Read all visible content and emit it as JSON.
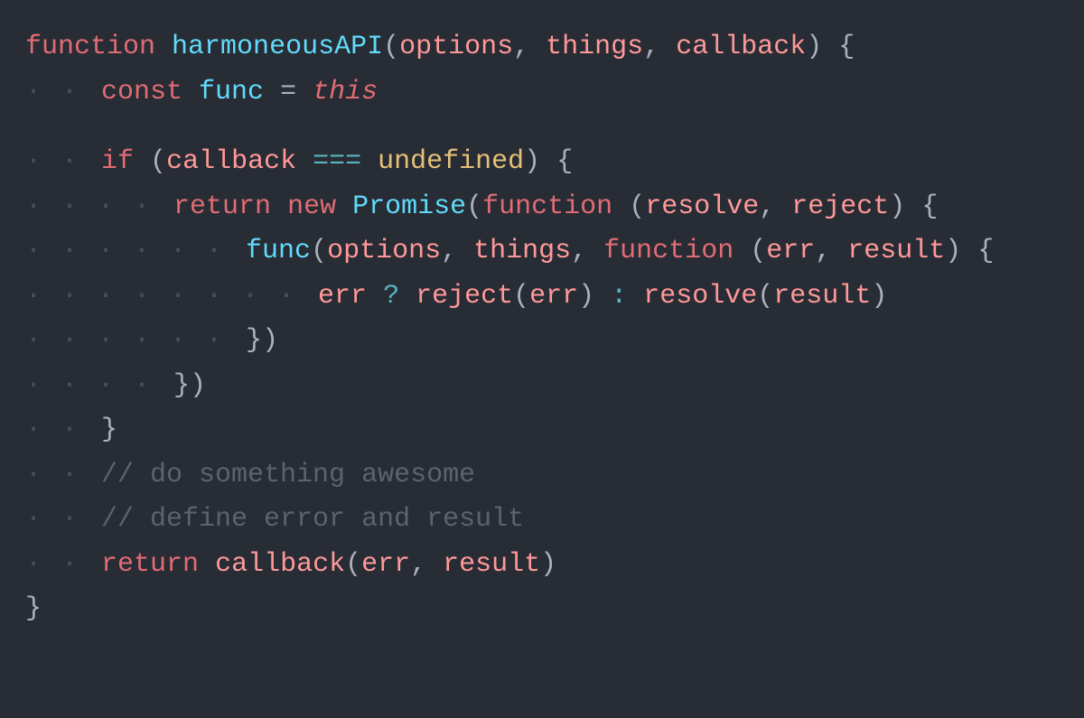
{
  "code": {
    "background": "#282c34",
    "lines": [
      {
        "id": "line1",
        "indent": 0,
        "content": "function harmoneousAPI(options, things, callback) {"
      },
      {
        "id": "line2",
        "indent": 1,
        "content": "const func = this"
      },
      {
        "id": "line3",
        "indent": 0,
        "content": ""
      },
      {
        "id": "line4",
        "indent": 1,
        "content": "if (callback === undefined) {"
      },
      {
        "id": "line5",
        "indent": 2,
        "content": "return new Promise(function (resolve, reject) {"
      },
      {
        "id": "line6",
        "indent": 3,
        "content": "func(options, things, function (err, result) {"
      },
      {
        "id": "line7",
        "indent": 4,
        "content": "err ? reject(err) : resolve(result)"
      },
      {
        "id": "line8",
        "indent": 3,
        "content": "})"
      },
      {
        "id": "line9",
        "indent": 2,
        "content": "})"
      },
      {
        "id": "line10",
        "indent": 1,
        "content": "}"
      },
      {
        "id": "line11",
        "indent": 1,
        "content": "// do something awesome"
      },
      {
        "id": "line12",
        "indent": 1,
        "content": "// define error and result"
      },
      {
        "id": "line13",
        "indent": 1,
        "content": "return callback(err, result)"
      },
      {
        "id": "line14",
        "indent": 0,
        "content": "}"
      }
    ]
  }
}
